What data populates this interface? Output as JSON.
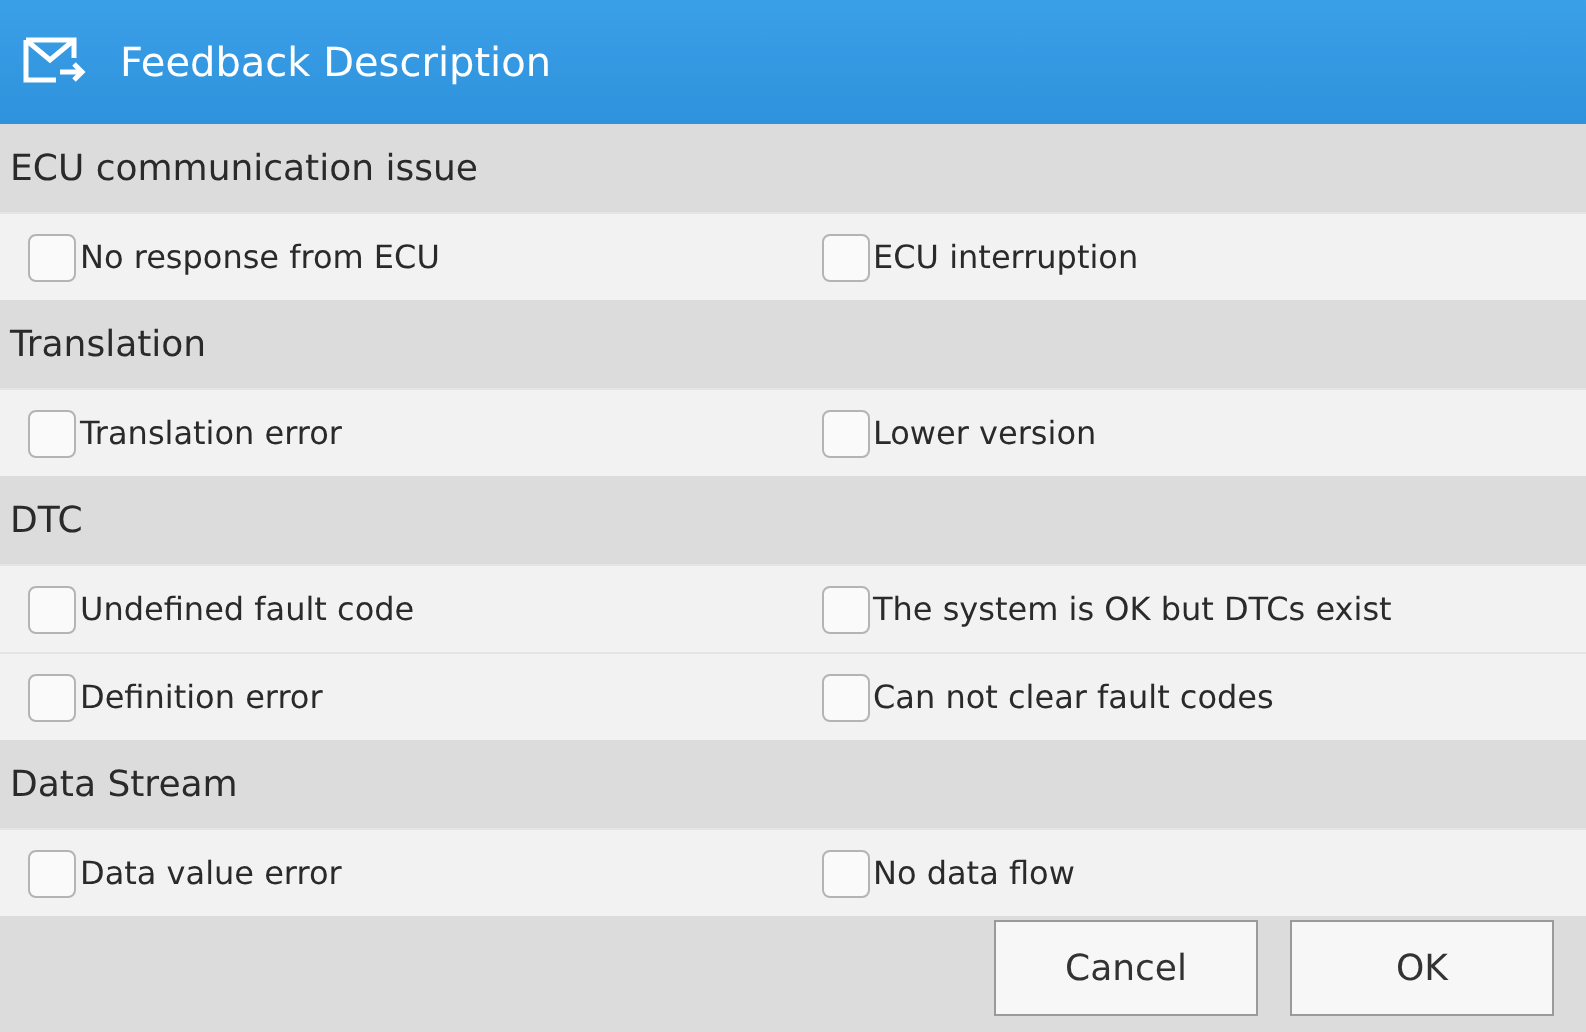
{
  "window": {
    "title": "Feedback Description"
  },
  "sections": [
    {
      "title": "ECU communication issue",
      "rows": [
        [
          {
            "label": "No response from ECU",
            "checked": false
          },
          {
            "label": "ECU interruption",
            "checked": false
          }
        ]
      ]
    },
    {
      "title": "Translation",
      "rows": [
        [
          {
            "label": "Translation error",
            "checked": false
          },
          {
            "label": "Lower version",
            "checked": false
          }
        ]
      ]
    },
    {
      "title": "DTC",
      "rows": [
        [
          {
            "label": "Undefined fault code",
            "checked": false
          },
          {
            "label": "The system is OK but DTCs exist",
            "checked": false
          }
        ],
        [
          {
            "label": "Definition error",
            "checked": false
          },
          {
            "label": "Can not clear fault codes",
            "checked": false
          }
        ]
      ]
    },
    {
      "title": "Data Stream",
      "rows": [
        [
          {
            "label": "Data value error",
            "checked": false
          },
          {
            "label": "No data flow",
            "checked": false
          }
        ]
      ]
    }
  ],
  "buttons": [
    "Cancel",
    "OK"
  ]
}
